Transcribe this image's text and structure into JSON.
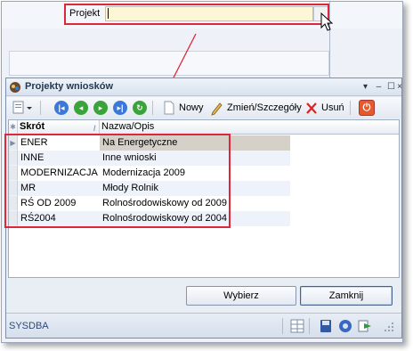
{
  "background": {
    "projekt_label": "Projekt",
    "projekt_value": ""
  },
  "dialog": {
    "title": "Projekty wniosków",
    "toolbar": {
      "new_label": "Nowy",
      "edit_label": "Zmień/Szczegóły",
      "delete_label": "Usuń"
    },
    "grid": {
      "columns": [
        "Skrót",
        "Nazwa/Opis"
      ],
      "rows": [
        {
          "code": "ENER",
          "name": "Na Energetyczne"
        },
        {
          "code": "INNE",
          "name": "Inne wnioski"
        },
        {
          "code": "MODERNIZACJA",
          "name": "Modernizacja 2009"
        },
        {
          "code": "MR",
          "name": "Młody Rolnik"
        },
        {
          "code": "RŚ OD 2009",
          "name": "Rolnośrodowiskowy od 2009"
        },
        {
          "code": "RŚ2004",
          "name": "Rolnośrodowiskowy od 2004"
        }
      ],
      "selected_row": 0
    },
    "buttons": {
      "select_label": "Wybierz",
      "close_label": "Zamknij"
    },
    "status": {
      "user": "SYSDBA"
    }
  },
  "colors": {
    "highlight": "#e0263a",
    "projekt_field": "#fdf7d8",
    "selected_row": "#d5d0c8"
  }
}
